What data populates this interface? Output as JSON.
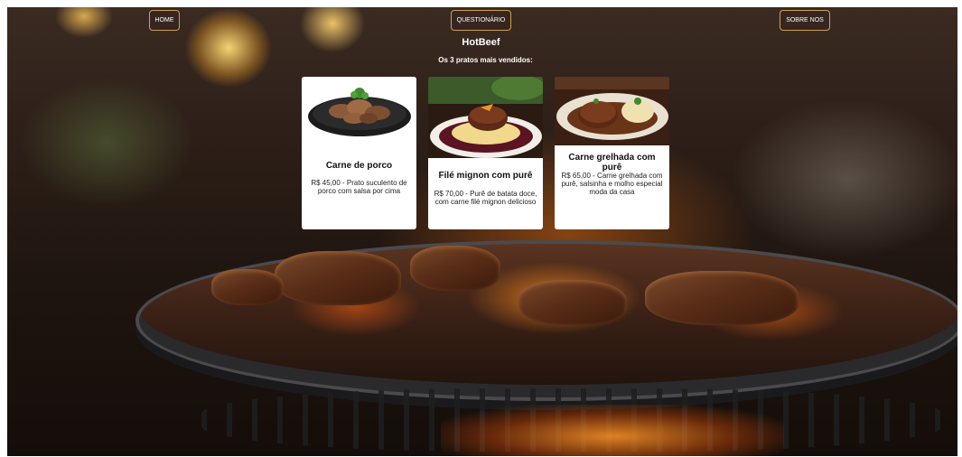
{
  "nav": {
    "home": "HOME",
    "questionnaire": "QUESTIONÁRIO",
    "about": "SOBRE NOS"
  },
  "brand": {
    "name": "HotBeef",
    "subtitle": "Os 3 pratos mais vendidos:"
  },
  "dishes": [
    {
      "title": "Carne de porco",
      "description": "R$ 45,00 - Prato suculento de porco com salsa por cima"
    },
    {
      "title": "Filé mignon com purê",
      "description": "R$ 70,00 - Purê de batata doce, com carne filé mignon delicioso"
    },
    {
      "title": "Carne grelhada com purê",
      "description": "R$ 65,00 - Carne grelhada com purê, salsinha e molho especial moda da casa"
    }
  ],
  "colors": {
    "nav_border": "#d2a24a",
    "card_background": "#ffffff",
    "text_light": "#ffffff"
  }
}
